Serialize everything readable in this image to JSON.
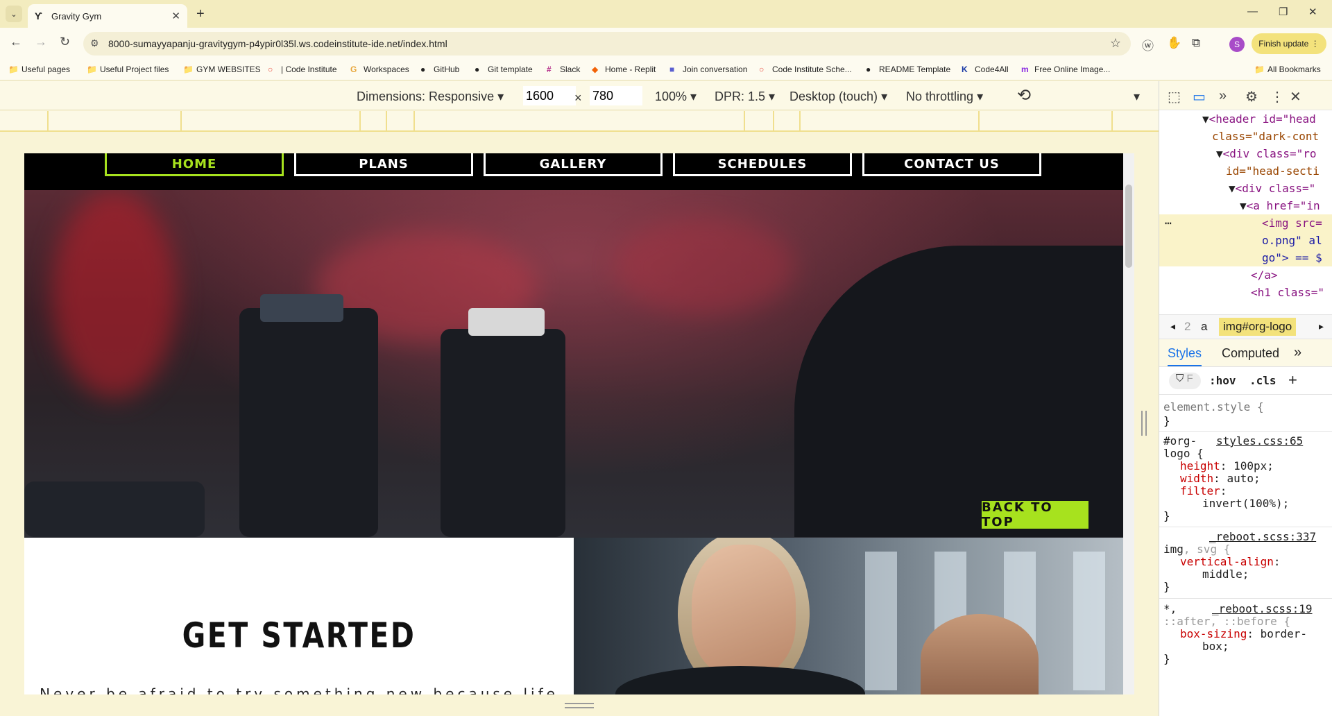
{
  "tab": {
    "title": "Gravity Gym",
    "favicon": "ϒ"
  },
  "address": {
    "url": "8000-sumayyapanju-gravitygym-p4ypir0l35l.ws.codeinstitute-ide.net/index.html"
  },
  "toolbar": {
    "finish_update": "Finish update",
    "profile_initial": "S"
  },
  "bookmarks": [
    {
      "label": "Useful pages",
      "icon": "📁"
    },
    {
      "label": "Useful Project files",
      "icon": "📁"
    },
    {
      "label": "GYM WEBSITES",
      "icon": "📁"
    },
    {
      "label": "| Code Institute",
      "icon": "○"
    },
    {
      "label": "Workspaces",
      "icon": "G"
    },
    {
      "label": "GitHub",
      "icon": "●"
    },
    {
      "label": "Git template",
      "icon": "●"
    },
    {
      "label": "Slack",
      "icon": "#"
    },
    {
      "label": "Home - Replit",
      "icon": "◆"
    },
    {
      "label": "Join conversation",
      "icon": "■"
    },
    {
      "label": "Code Institute Sche...",
      "icon": "○"
    },
    {
      "label": "README Template",
      "icon": "●"
    },
    {
      "label": "Code4All",
      "icon": "K"
    },
    {
      "label": "Free Online Image...",
      "icon": "m"
    },
    {
      "label": "All Bookmarks",
      "icon": "📁"
    }
  ],
  "device": {
    "dimensions": "Dimensions: Responsive",
    "width": "1600",
    "height": "780",
    "times": "×",
    "zoom": "100%",
    "dpr": "DPR: 1.5",
    "mode": "Desktop (touch)",
    "throttling": "No throttling"
  },
  "site": {
    "nav": [
      "HOME",
      "PLANS",
      "GALLERY",
      "SCHEDULES",
      "CONTACT US"
    ],
    "get_started_title": "GET STARTED",
    "get_started_text": "Never be afraid to try something new because life",
    "back_to_top": "BACK TO TOP",
    "accent": "#a7e21e"
  },
  "devtools": {
    "dom": [
      "<header id=\"head",
      "class=\"dark-cont",
      "<div class=\"ro",
      "id=\"head-secti",
      "<div class=\"",
      "<a href=\"in",
      "<img src=",
      "o.png\" al",
      "go\"> == $",
      "</a>",
      "<h1 class=\""
    ],
    "crumbs": [
      "2",
      "a",
      "img#org-logo"
    ],
    "style_tabs": [
      "Styles",
      "Computed"
    ],
    "filter_placeholder": "F",
    "hov": ":hov",
    "cls": ".cls",
    "rules": {
      "element_style": "element.style {",
      "close": "}",
      "org_logo_selector_1": "#org-",
      "org_logo_selector_2": "logo {",
      "org_logo_file": "styles.css:65",
      "height_prop": "height",
      "height_val": "100px;",
      "width_prop": "width",
      "width_val": "auto;",
      "filter_prop": "filter",
      "filter_val": "invert(100%);",
      "reboot_file_1": "_reboot.scss:337",
      "img_selector": "img",
      "svg_selector": ", svg {",
      "valign_prop": "vertical-align",
      "valign_val": "middle;",
      "universal_selector": "*,",
      "reboot_file_2": "_reboot.scss:19",
      "pseudo_selector": "::after, ::before {",
      "boxsizing_prop": "box-sizing",
      "boxsizing_val_1": "border-",
      "boxsizing_val_2": "box;"
    }
  }
}
